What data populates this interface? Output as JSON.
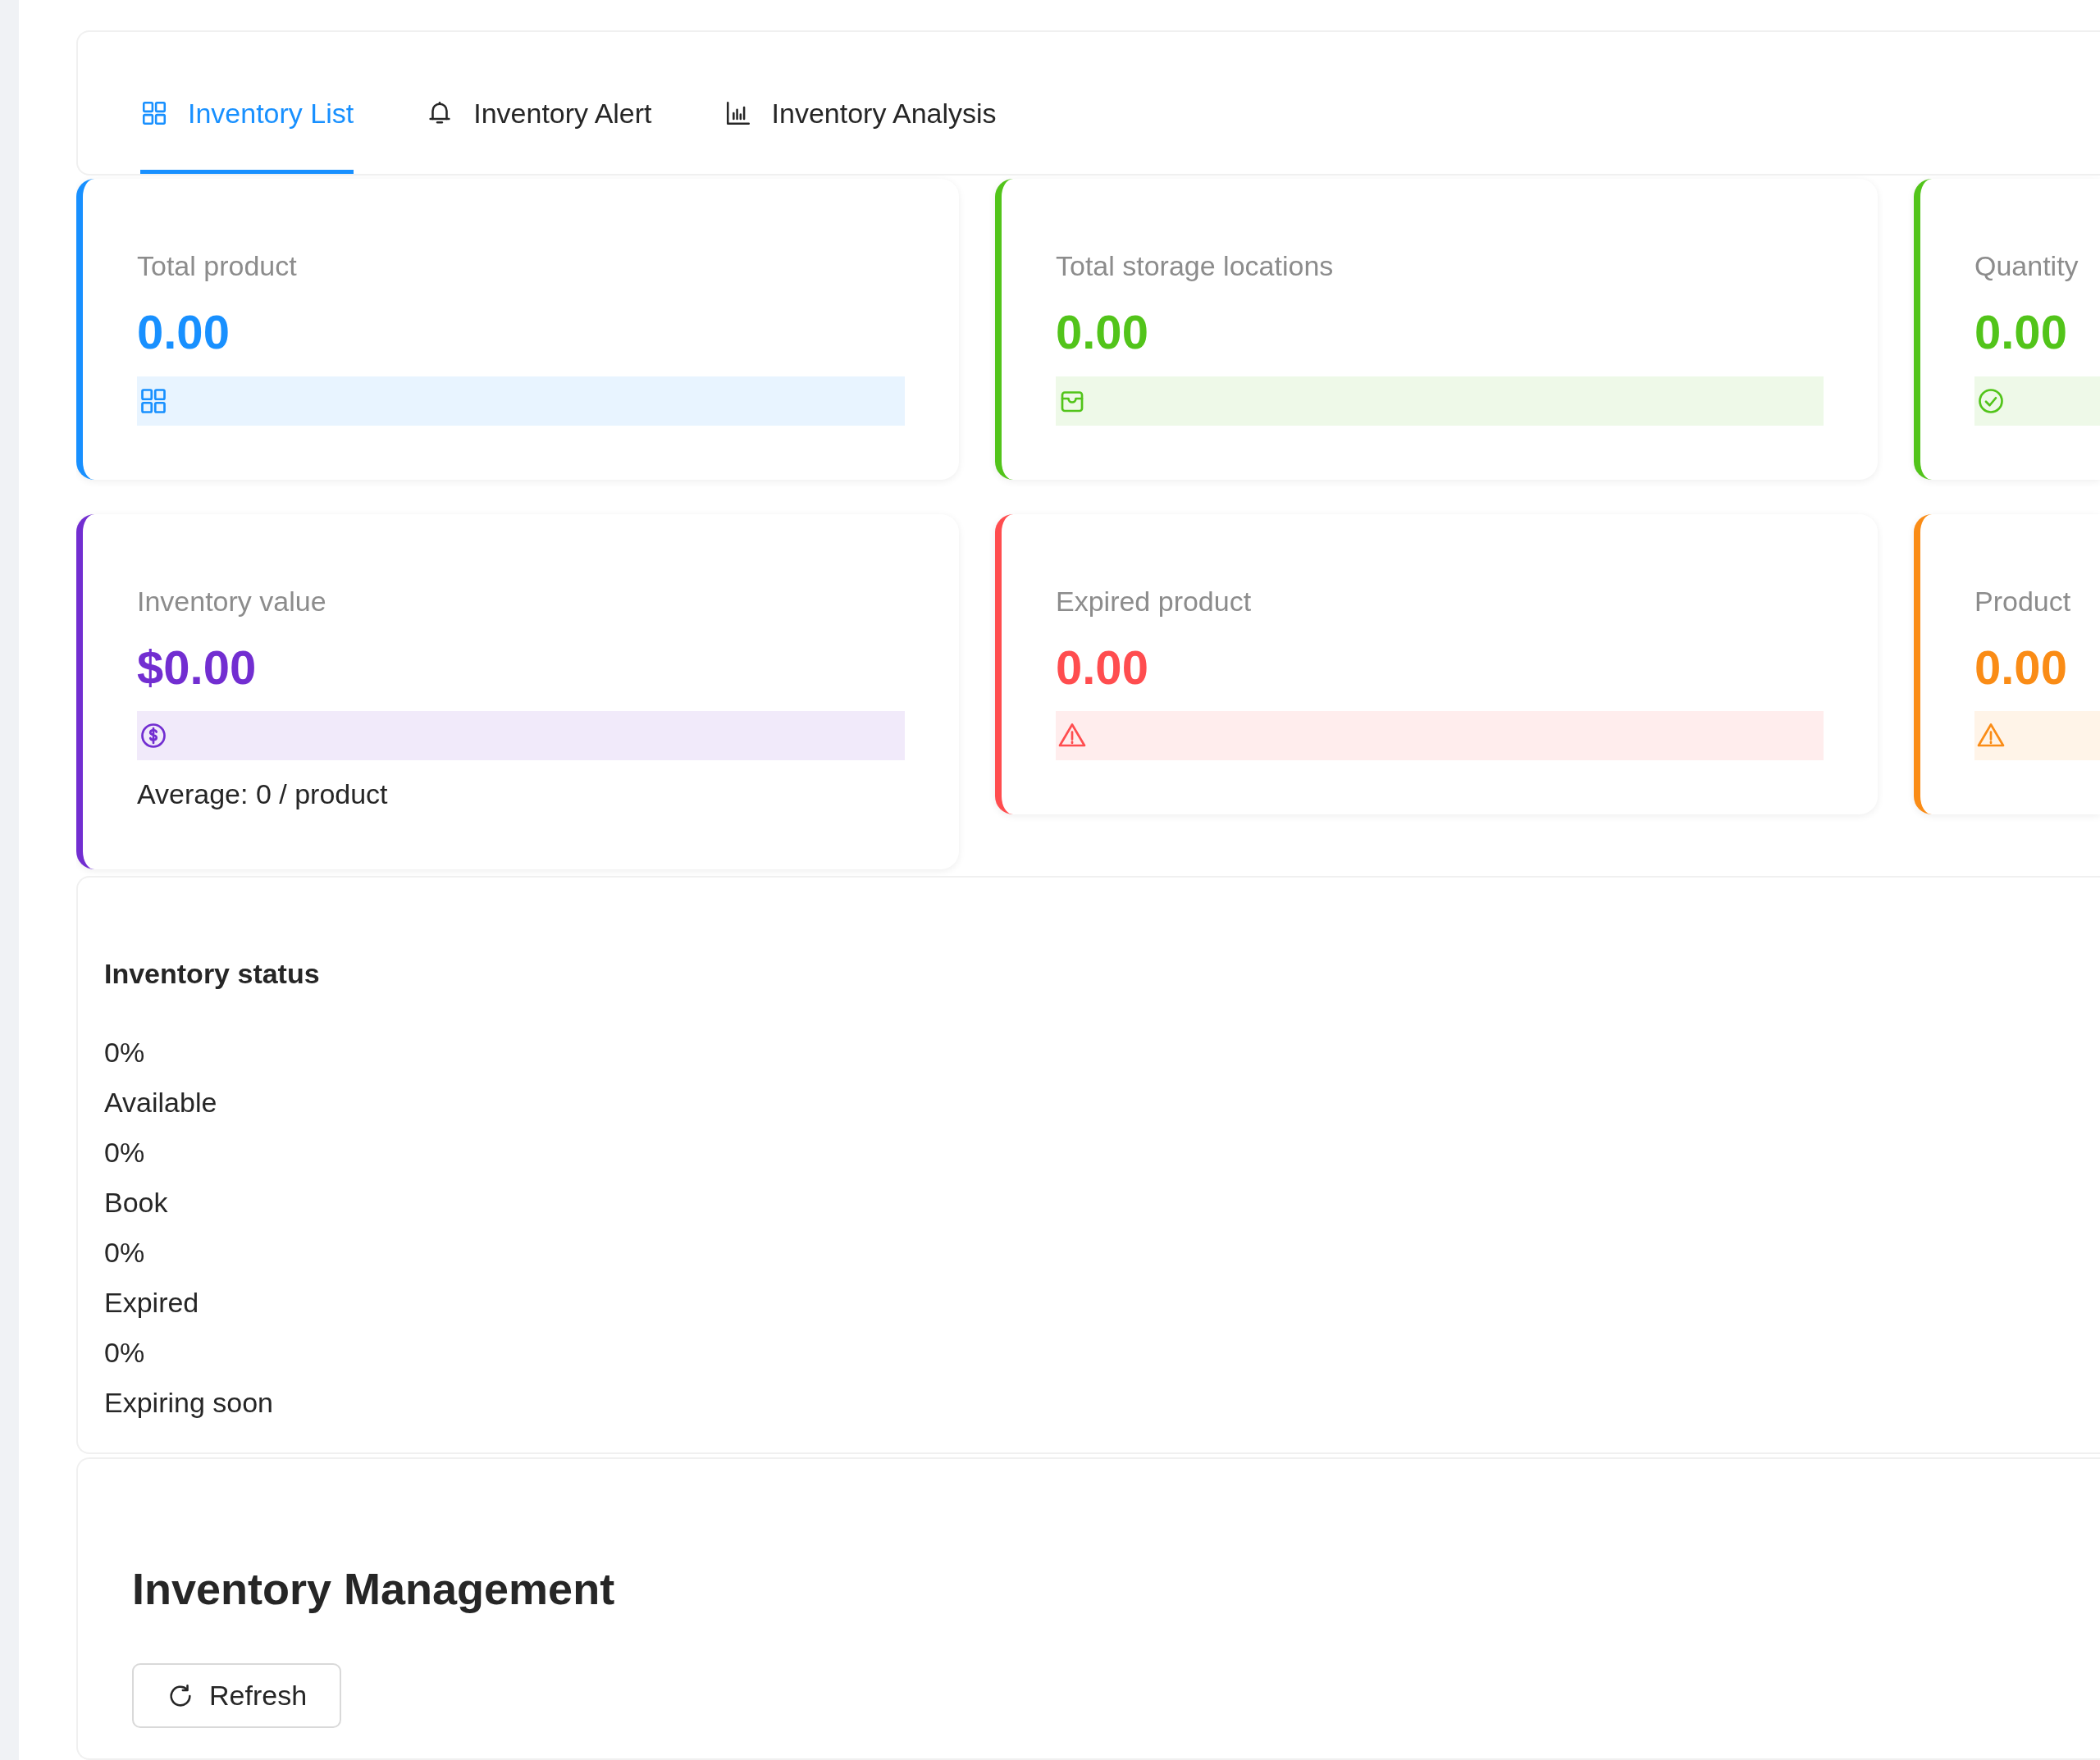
{
  "tabs": [
    {
      "label": "Inventory List",
      "kind": "grid",
      "selected": true
    },
    {
      "label": "Inventory Alert",
      "kind": "bell",
      "selected": false
    },
    {
      "label": "Inventory Analysis",
      "kind": "chart",
      "selected": false
    }
  ],
  "stat_rows": [
    {
      "cards": [
        {
          "label": "Total product",
          "value": "0.00",
          "kind": "grid",
          "color": "#1890ff"
        },
        {
          "label": "Total storage locations",
          "value": "0.00",
          "kind": "box",
          "color": "#52c41a"
        },
        {
          "label": "Quantity",
          "value": "0.00",
          "kind": "check",
          "color": "#52c41a"
        }
      ]
    },
    {
      "cards": [
        {
          "label": "Inventory value",
          "value": "$0.00",
          "kind": "money",
          "color": "#722ed1",
          "note": "Average: 0 / product"
        },
        {
          "label": "Expired product",
          "value": "0.00",
          "kind": "warning",
          "color": "#ff4d4f"
        },
        {
          "label": "Product",
          "value": "0.00",
          "kind": "warning",
          "color": "#fa8c16"
        }
      ]
    }
  ],
  "inventory_status": {
    "title": "Inventory status",
    "items": [
      {
        "percent": "0%",
        "label": "Available"
      },
      {
        "percent": "0%",
        "label": "Book"
      },
      {
        "percent": "0%",
        "label": "Expired"
      },
      {
        "percent": "0%",
        "label": "Expiring soon"
      }
    ]
  },
  "management": {
    "title": "Inventory Management",
    "refresh_button": "Refresh"
  }
}
